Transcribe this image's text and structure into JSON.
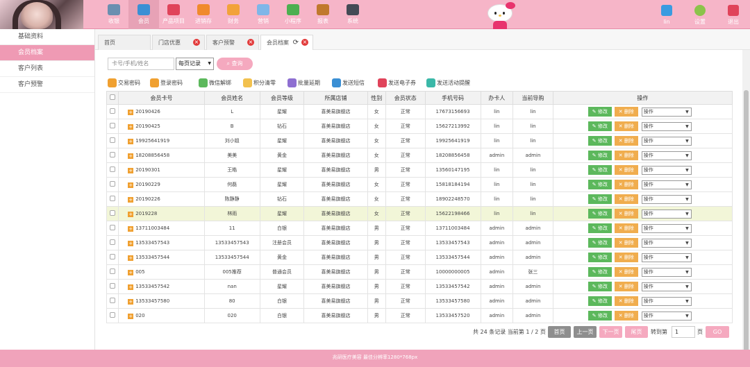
{
  "nav": [
    {
      "label": "收银",
      "icon": "cash-register-icon",
      "color": "#6b8fb0"
    },
    {
      "label": "会员",
      "icon": "member-icon",
      "color": "#3a8fd4",
      "active": true
    },
    {
      "label": "产品项目",
      "icon": "product-icon",
      "color": "#e0435a"
    },
    {
      "label": "进销存",
      "icon": "inventory-icon",
      "color": "#f08a2c"
    },
    {
      "label": "财务",
      "icon": "finance-icon",
      "color": "#f2a23a"
    },
    {
      "label": "营销",
      "icon": "megaphone-icon",
      "color": "#7fb6e8"
    },
    {
      "label": "小程序",
      "icon": "wechat-icon",
      "color": "#4caf50"
    },
    {
      "label": "报表",
      "icon": "report-icon",
      "color": "#c0782d"
    },
    {
      "label": "系统",
      "icon": "monitor-icon",
      "color": "#444a55"
    }
  ],
  "user": {
    "label": "lin",
    "icon": "user-icon",
    "color": "#3a9be0"
  },
  "settings": {
    "label": "设置",
    "icon": "gear-icon",
    "color": "#8bc34a"
  },
  "logout": {
    "label": "退出",
    "icon": "logout-icon",
    "color": "#e0435a"
  },
  "sidebar": [
    {
      "label": "基础资料"
    },
    {
      "label": "会员档案",
      "active": true
    },
    {
      "label": "客户列表"
    },
    {
      "label": "客户预警"
    }
  ],
  "tabs": [
    {
      "label": "首页"
    },
    {
      "label": "门店优惠"
    },
    {
      "label": "客户预警"
    },
    {
      "label": "会员档案",
      "active": true
    }
  ],
  "search": {
    "placeholder": "卡号/手机/姓名",
    "per_page": "每页记录",
    "button": "查询"
  },
  "tools": [
    {
      "label": "交易密码",
      "color": "#f0a030"
    },
    {
      "label": "登录密码",
      "color": "#f0a030"
    },
    {
      "label": "微信解绑",
      "color": "#5cb85c"
    },
    {
      "label": "积分清零",
      "color": "#f2c14e"
    },
    {
      "label": "批量延期",
      "color": "#8e6fd1"
    },
    {
      "label": "发送短信",
      "color": "#3a8fd4"
    },
    {
      "label": "发送电子券",
      "color": "#e0435a"
    },
    {
      "label": "发送活动提醒",
      "color": "#3bb8a8"
    }
  ],
  "columns": [
    "会员卡号",
    "会员姓名",
    "会员等级",
    "所属店铺",
    "性别",
    "会员状态",
    "手机号码",
    "办卡人",
    "当前导购",
    "操作"
  ],
  "rows": [
    {
      "card": "20190426",
      "name": "L",
      "level": "星耀",
      "shop": "喜美易旗舰店",
      "gender": "女",
      "status": "正常",
      "phone": "17673156693",
      "handler": "lin",
      "guide": "lin"
    },
    {
      "card": "20190425",
      "name": "B",
      "level": "钻石",
      "shop": "喜美易旗舰店",
      "gender": "女",
      "status": "正常",
      "phone": "15627213992",
      "handler": "lin",
      "guide": "lin"
    },
    {
      "card": "19925641919",
      "name": "刘小姐",
      "level": "星耀",
      "shop": "喜美易旗舰店",
      "gender": "女",
      "status": "正常",
      "phone": "19925641919",
      "handler": "lin",
      "guide": "lin"
    },
    {
      "card": "18208856458",
      "name": "美美",
      "level": "黄金",
      "shop": "喜美易旗舰店",
      "gender": "女",
      "status": "正常",
      "phone": "18208856458",
      "handler": "admin",
      "guide": "admin"
    },
    {
      "card": "20190301",
      "name": "王皓",
      "level": "星耀",
      "shop": "喜美易旗舰店",
      "gender": "男",
      "status": "正常",
      "phone": "13560147195",
      "handler": "lin",
      "guide": "lin"
    },
    {
      "card": "20190229",
      "name": "何磊",
      "level": "星耀",
      "shop": "喜美易旗舰店",
      "gender": "女",
      "status": "正常",
      "phone": "15818184194",
      "handler": "lin",
      "guide": "lin"
    },
    {
      "card": "20190226",
      "name": "陈静静",
      "level": "钻石",
      "shop": "喜美易旗舰店",
      "gender": "女",
      "status": "正常",
      "phone": "18902248570",
      "handler": "lin",
      "guide": "lin"
    },
    {
      "card": "2019228",
      "name": "林雨",
      "level": "星耀",
      "shop": "喜美易旗舰店",
      "gender": "女",
      "status": "正常",
      "phone": "15622198466",
      "handler": "lin",
      "guide": "lin",
      "highlight": true
    },
    {
      "card": "13711003484",
      "name": "11",
      "level": "白银",
      "shop": "喜美易旗舰店",
      "gender": "男",
      "status": "正常",
      "phone": "13711003484",
      "handler": "admin",
      "guide": "admin"
    },
    {
      "card": "13533457543",
      "name": "13533457543",
      "level": "注册会员",
      "shop": "喜美易旗舰店",
      "gender": "男",
      "status": "正常",
      "phone": "13533457543",
      "handler": "admin",
      "guide": "admin"
    },
    {
      "card": "13533457544",
      "name": "13533457544",
      "level": "黄金",
      "shop": "喜美易旗舰店",
      "gender": "男",
      "status": "正常",
      "phone": "13533457544",
      "handler": "admin",
      "guide": "admin"
    },
    {
      "card": "005",
      "name": "005推荐",
      "level": "普通会员",
      "shop": "喜美易旗舰店",
      "gender": "男",
      "status": "正常",
      "phone": "10000000005",
      "handler": "admin",
      "guide": "张三"
    },
    {
      "card": "13533457542",
      "name": "nan",
      "level": "星耀",
      "shop": "喜美易旗舰店",
      "gender": "男",
      "status": "正常",
      "phone": "13533457542",
      "handler": "admin",
      "guide": "admin"
    },
    {
      "card": "13533457580",
      "name": "80",
      "level": "白银",
      "shop": "喜美易旗舰店",
      "gender": "男",
      "status": "正常",
      "phone": "13533457580",
      "handler": "admin",
      "guide": "admin"
    },
    {
      "card": "020",
      "name": "020",
      "level": "白银",
      "shop": "喜美易旗舰店",
      "gender": "男",
      "status": "正常",
      "phone": "13533457520",
      "handler": "admin",
      "guide": "admin"
    }
  ],
  "row_actions": {
    "edit": "修改",
    "delete": "删除",
    "select": "操作"
  },
  "pager": {
    "info": "共 24 条记录 当前第 1 / 2 页",
    "first": "首页",
    "prev": "上一页",
    "next": "下一页",
    "last": "尾页",
    "goto": "转到第",
    "goto_value": "1",
    "page_unit": "页",
    "go": "GO"
  },
  "footer": "兆研医疗美容   最佳分辨率1280*768px",
  "colors": {
    "brand": "#f6b5c8",
    "accent": "#ef9ab4",
    "edit": "#5cb85c",
    "delete": "#f0ad4e",
    "link": "#2a89c0"
  }
}
